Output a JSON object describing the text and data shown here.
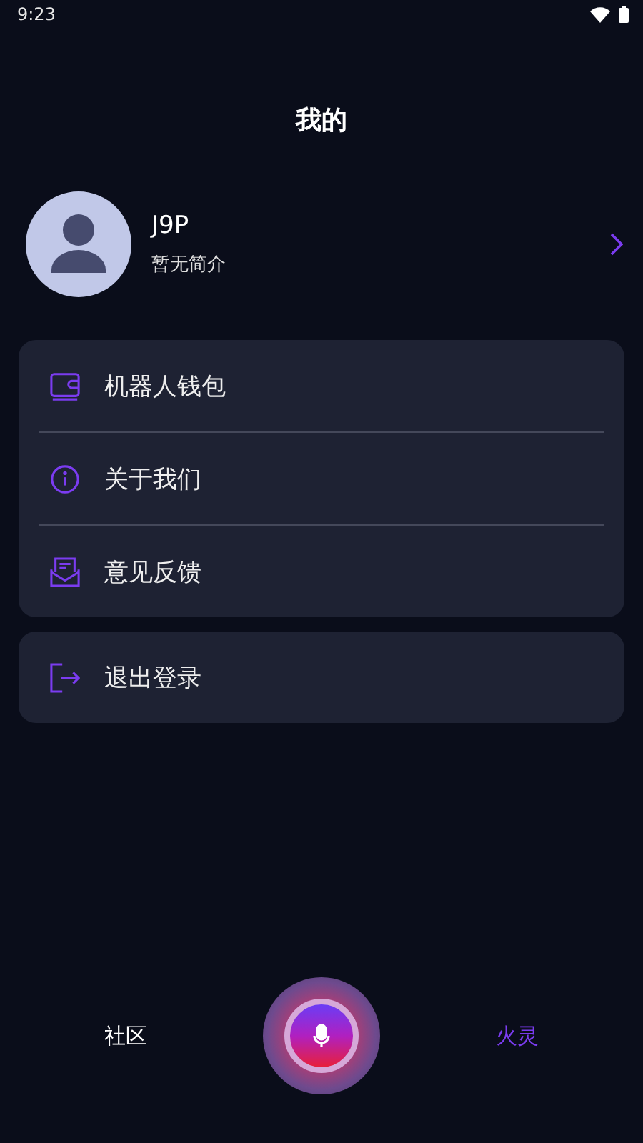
{
  "status_bar": {
    "time": "9:23"
  },
  "header": {
    "title": "我的"
  },
  "profile": {
    "name": "J9P",
    "bio": "暂无简介"
  },
  "menu": [
    {
      "kind": "wallet",
      "label": "机器人钱包"
    },
    {
      "kind": "info",
      "label": "关于我们"
    },
    {
      "kind": "feedback",
      "label": "意见反馈"
    }
  ],
  "logout": {
    "kind": "logout",
    "label": "退出登录"
  },
  "bottom_nav": [
    {
      "label": "社区",
      "selected": false
    },
    {
      "label": "火灵",
      "selected": true
    }
  ]
}
